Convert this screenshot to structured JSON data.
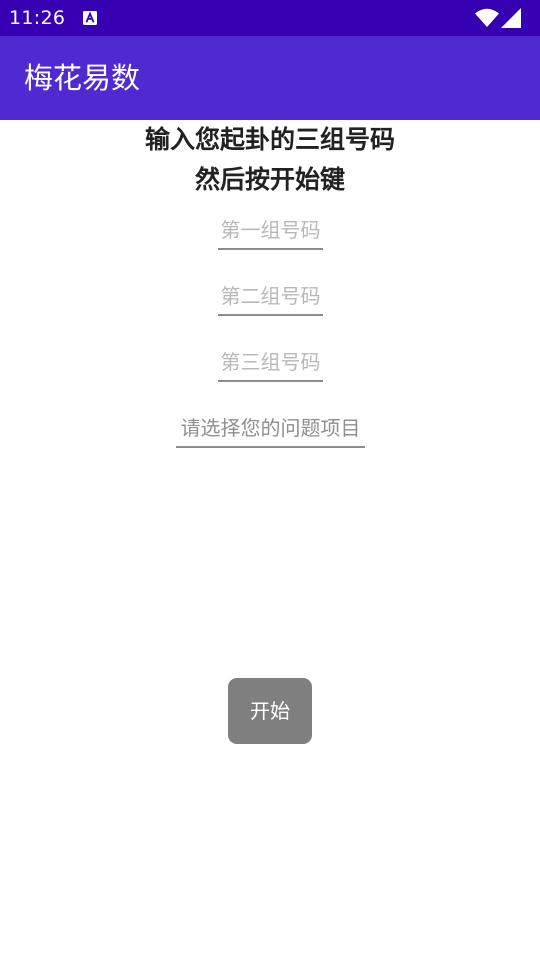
{
  "status_bar": {
    "time": "11:26",
    "notification_icon": "text-a-icon",
    "wifi_icon": "wifi-icon",
    "signal_icon": "cell-signal-icon",
    "background_color": "#3700b3"
  },
  "app_bar": {
    "title": "梅花易数",
    "background_color": "#5029d0"
  },
  "main": {
    "instruction_line1": "输入您起卦的三组号码",
    "instruction_line2": "然后按开始键",
    "first_number_placeholder": "第一组号码",
    "second_number_placeholder": "第二组号码",
    "third_number_placeholder": "第三组号码",
    "question_placeholder": "请选择您的问题项目",
    "start_label": "开始",
    "start_button_color": "#7f7f7f"
  }
}
